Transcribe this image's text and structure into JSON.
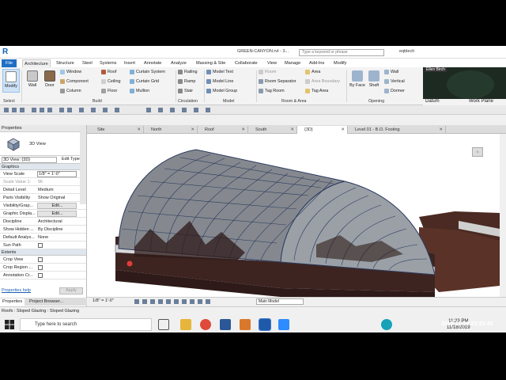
{
  "app": {
    "title": "GREEN-CANYON.rvt - 3...",
    "search_placeholder": "Type a keyword or phrase",
    "user": "eqblech"
  },
  "ribbon_tabs": [
    "File",
    "Architecture",
    "Structure",
    "Steel",
    "Systems",
    "Insert",
    "Annotate",
    "Analyze",
    "Massing & Site",
    "Collaborate",
    "View",
    "Manage",
    "Add-Ins",
    "Modify"
  ],
  "ribbon": {
    "modify": "Modify",
    "select": "Select",
    "wall": "Wall",
    "door": "Door",
    "window": "Window",
    "component": "Component",
    "column": "Column",
    "roof": "Roof",
    "ceiling": "Ceiling",
    "floor": "Floor",
    "curtain_system": "Curtain System",
    "curtain_grid": "Curtain Grid",
    "mullion": "Mullion",
    "railing": "Railing",
    "ramp": "Ramp",
    "stair": "Stair",
    "model_text": "Model Text",
    "model_line": "Model Line",
    "model_group": "Model Group",
    "room": "Room",
    "room_separator": "Room Separator",
    "tag_room": "Tag Room",
    "area": "Area",
    "area_boundary": "Area Boundary",
    "tag_area": "Tag Area",
    "by_face": "By Face",
    "shaft": "Shaft",
    "wall_open": "Wall",
    "vertical": "Vertical",
    "dormer": "Dormer",
    "panels": [
      "Build",
      "Circulation",
      "Model",
      "Room & Area",
      "Opening",
      "Datum",
      "Work Plane"
    ]
  },
  "webcam": {
    "name": "Ellen Birch"
  },
  "properties": {
    "header": "Properties",
    "type_name": "3D View",
    "instance": "3D View: {3D}",
    "edit_type": "Edit Type",
    "sections": {
      "graphics": "Graphics",
      "extents": "Extents"
    },
    "rows": [
      {
        "k": "View Scale",
        "v": "1/8\" = 1'-0\""
      },
      {
        "k": "Scale Value    1:",
        "v": "96"
      },
      {
        "k": "Detail Level",
        "v": "Medium"
      },
      {
        "k": "Parts Visibility",
        "v": "Show Original"
      },
      {
        "k": "Visibility/Grap...",
        "v": "Edit..."
      },
      {
        "k": "Graphic Displa...",
        "v": "Edit..."
      },
      {
        "k": "Discipline",
        "v": "Architectural"
      },
      {
        "k": "Show Hidden ...",
        "v": "By Discipline"
      },
      {
        "k": "Default Analys...",
        "v": "None"
      },
      {
        "k": "Sun Path",
        "v": ""
      }
    ],
    "extent_rows": [
      "Crop View",
      "Crop Region ...",
      "Annotation Cr..."
    ],
    "help": "Properties help",
    "apply": "Apply",
    "tabs": [
      "Properties",
      "Project Browser..."
    ]
  },
  "view_tabs": [
    "Site",
    "North",
    "Roof",
    "South",
    "{3D}",
    "Level 01 - B.O. Footing"
  ],
  "view_control": {
    "scale": "1/8\" = 1'-0\"",
    "model": "Main Model"
  },
  "status": "Roofs : Sloped Glazing : Sloped Glazing",
  "taskbar": {
    "search": "Type here to search",
    "time": "11:23 PM",
    "date": "11/18/2019"
  },
  "overlay_timestamp": "2019-11-18 23:23:49",
  "colors": {
    "accent": "#1f6fc5",
    "ground": "#4a2e26",
    "glazing": "#8a8f94",
    "frame": "#2c3a5e"
  }
}
